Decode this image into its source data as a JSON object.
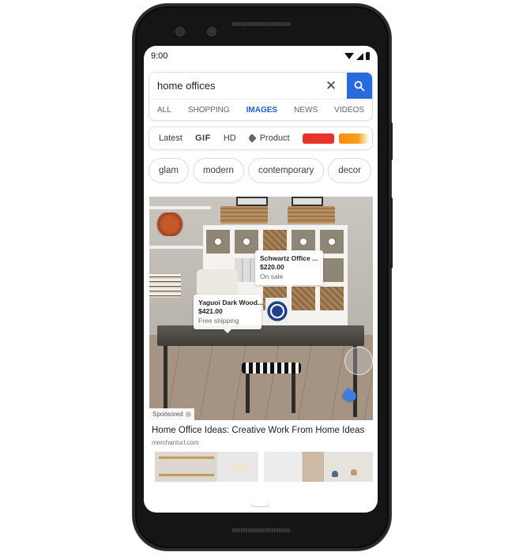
{
  "status_bar": {
    "time": "9:00",
    "icons": [
      "wifi-icon",
      "signal-icon",
      "battery-icon"
    ]
  },
  "search": {
    "query": "home offices",
    "clear_icon": "✕",
    "search_icon": "search-icon"
  },
  "tabs": [
    {
      "label": "ALL",
      "active": false
    },
    {
      "label": "SHOPPING",
      "active": false
    },
    {
      "label": "IMAGES",
      "active": true
    },
    {
      "label": "NEWS",
      "active": false
    },
    {
      "label": "VIDEOS",
      "active": false
    }
  ],
  "filters": {
    "items": [
      "Latest",
      "GIF",
      "HD",
      "Product"
    ],
    "color_swatches": [
      "#e8322c",
      "#f98d0c"
    ]
  },
  "chips": [
    "glam",
    "modern",
    "contemporary",
    "decor"
  ],
  "main_result": {
    "product_tags": [
      {
        "title": "Schwartz Office ...",
        "price": "$220.00",
        "note": "On sale"
      },
      {
        "title": "Yaguoi Dark Wood...",
        "price": "$421.00",
        "note": "Free shipping"
      }
    ],
    "sponsored_label": "Sponsored",
    "title": "Home Office Ideas: Creative Work From Home Ideas",
    "url": "merchanturl.com"
  },
  "colors": {
    "accent_blue": "#1a5ed8",
    "search_button": "#2a6ae0",
    "tag_blue": "#3c7fe0"
  }
}
